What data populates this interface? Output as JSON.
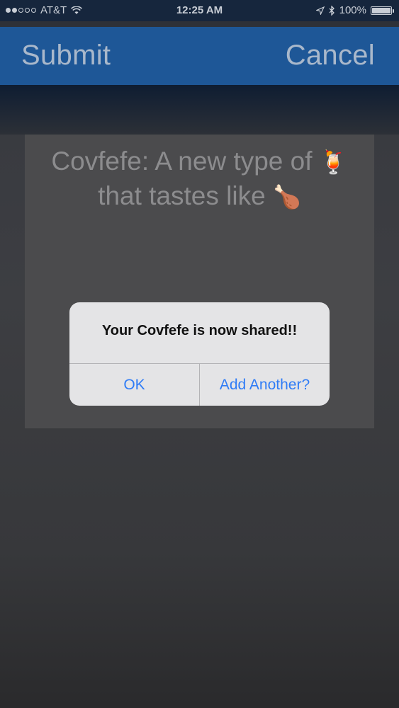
{
  "status_bar": {
    "carrier": "AT&T",
    "time": "12:25 AM",
    "battery_percent": "100%",
    "battery_level": 1.0
  },
  "nav": {
    "submit_label": "Submit",
    "cancel_label": "Cancel"
  },
  "card": {
    "line1_text": "Covfefe: A new type of",
    "line1_emoji": "🍹",
    "line2_text": "that tastes like",
    "line2_emoji": "🍗"
  },
  "alert": {
    "title": "Your Covfefe is now shared!!",
    "ok_label": "OK",
    "add_another_label": "Add Another?"
  },
  "colors": {
    "nav_bar": "#1e5797",
    "alert_button": "#2f7cf6"
  }
}
